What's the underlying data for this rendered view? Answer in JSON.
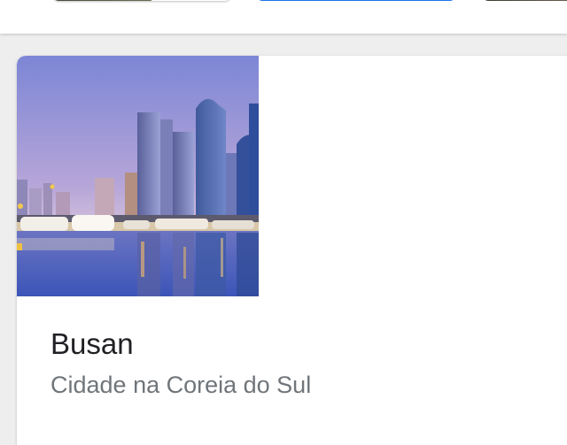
{
  "result_card": {
    "title": "Busan",
    "subtitle": "Cidade na Coreia do Sul",
    "image_subject": "city-skyline-marina"
  },
  "colors": {
    "accent": "#1a73e8",
    "title_text": "#202124",
    "subtitle_text": "#70757a",
    "page_background": "#eeeeee"
  }
}
